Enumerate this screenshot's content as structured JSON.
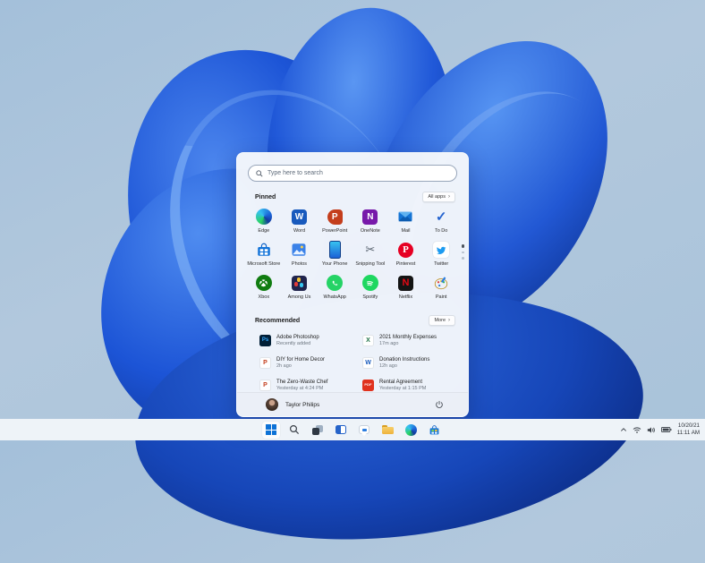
{
  "colors": {
    "accent": "#0067c0",
    "panel_bg": "#f4f7fb",
    "taskbar_bg": "#eef3f8",
    "bloom_blue_dark": "#0b2f8f",
    "bloom_blue_mid": "#1c54d6",
    "bloom_blue_light": "#4f8cf0",
    "desktop_bg": "#aac4dc"
  },
  "search": {
    "placeholder": "Type here to search"
  },
  "pinned": {
    "title": "Pinned",
    "all_apps_label": "All apps",
    "chevron": "›",
    "apps": [
      {
        "label": "Edge",
        "glyph": ""
      },
      {
        "label": "Word",
        "glyph": "W"
      },
      {
        "label": "PowerPoint",
        "glyph": "P"
      },
      {
        "label": "OneNote",
        "glyph": "N"
      },
      {
        "label": "Mail",
        "glyph": ""
      },
      {
        "label": "To Do",
        "glyph": "✓"
      },
      {
        "label": "Microsoft Store",
        "glyph": ""
      },
      {
        "label": "Photos",
        "glyph": ""
      },
      {
        "label": "Your Phone",
        "glyph": ""
      },
      {
        "label": "Snipping Tool",
        "glyph": "✂"
      },
      {
        "label": "Pinterest",
        "glyph": "P"
      },
      {
        "label": "Twitter",
        "glyph": ""
      },
      {
        "label": "Xbox",
        "glyph": ""
      },
      {
        "label": "Among Us",
        "glyph": ""
      },
      {
        "label": "WhatsApp",
        "glyph": ""
      },
      {
        "label": "Spotify",
        "glyph": ""
      },
      {
        "label": "Netflix",
        "glyph": "N"
      },
      {
        "label": "Paint",
        "glyph": ""
      }
    ]
  },
  "recommended": {
    "title": "Recommended",
    "more_label": "More",
    "chevron": "›",
    "items": [
      {
        "title": "Adobe Photoshop",
        "subtitle": "Recently added",
        "badge": "Ps"
      },
      {
        "title": "2021 Monthly Expenses",
        "subtitle": "17m ago",
        "badge": "X"
      },
      {
        "title": "DIY for Home Decor",
        "subtitle": "2h ago",
        "badge": "P"
      },
      {
        "title": "Donation Instructions",
        "subtitle": "12h ago",
        "badge": "W"
      },
      {
        "title": "The Zero-Waste Chef",
        "subtitle": "Yesterday at 4:24 PM",
        "badge": "P"
      },
      {
        "title": "Rental Agreement",
        "subtitle": "Yesterday at 1:15 PM",
        "badge": "PDF"
      }
    ]
  },
  "footer": {
    "user_name": "Taylor Philips"
  },
  "tray": {
    "date": "10/20/21",
    "time": "11:11 AM"
  }
}
